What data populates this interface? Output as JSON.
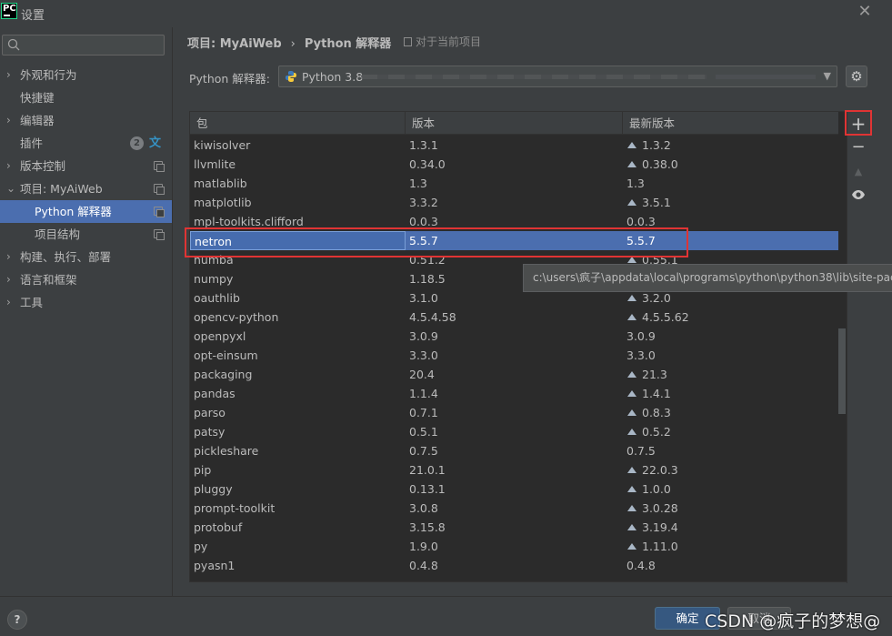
{
  "window": {
    "title": "设置",
    "app_logo_text": "PC"
  },
  "sidebar": {
    "search_placeholder": "Q-",
    "items": [
      {
        "label": "外观和行为",
        "has_chevron": true
      },
      {
        "label": "快捷键",
        "has_chevron": false
      },
      {
        "label": "编辑器",
        "has_chevron": true
      },
      {
        "label": "插件",
        "has_chevron": false,
        "badge": "2"
      },
      {
        "label": "版本控制",
        "has_chevron": true
      },
      {
        "label": "项目: MyAiWeb",
        "has_chevron": true,
        "expanded": true
      },
      {
        "label": "Python 解释器",
        "child": true,
        "selected": true
      },
      {
        "label": "项目结构",
        "child": true
      },
      {
        "label": "构建、执行、部署",
        "has_chevron": true
      },
      {
        "label": "语言和框架",
        "has_chevron": true
      },
      {
        "label": "工具",
        "has_chevron": true
      }
    ]
  },
  "header": {
    "breadcrumb_project": "项目: MyAiWeb",
    "breadcrumb_sep": "›",
    "breadcrumb_page": "Python 解释器",
    "scope_label": "对于当前项目"
  },
  "interpreter": {
    "label": "Python 解释器:",
    "value": "Python 3.8"
  },
  "table": {
    "headers": [
      "包",
      "版本",
      "最新版本"
    ],
    "rows": [
      {
        "name": "kiwisolver",
        "version": "1.3.1",
        "latest": "1.3.2",
        "upgrade": true
      },
      {
        "name": "llvmlite",
        "version": "0.34.0",
        "latest": "0.38.0",
        "upgrade": true
      },
      {
        "name": "matlablib",
        "version": "1.3",
        "latest": "1.3",
        "upgrade": false
      },
      {
        "name": "matplotlib",
        "version": "3.3.2",
        "latest": "3.5.1",
        "upgrade": true
      },
      {
        "name": "mpl-toolkits.clifford",
        "version": "0.0.3",
        "latest": "0.0.3",
        "upgrade": false
      },
      {
        "name": "netron",
        "version": "5.5.7",
        "latest": "5.5.7",
        "upgrade": false,
        "selected": true
      },
      {
        "name": "numba",
        "version": "0.51.2",
        "latest": "0.55.1",
        "upgrade": true
      },
      {
        "name": "numpy",
        "version": "1.18.5",
        "latest": "",
        "upgrade": false
      },
      {
        "name": "oauthlib",
        "version": "3.1.0",
        "latest": "3.2.0",
        "upgrade": true
      },
      {
        "name": "opencv-python",
        "version": "4.5.4.58",
        "latest": "4.5.5.62",
        "upgrade": true
      },
      {
        "name": "openpyxl",
        "version": "3.0.9",
        "latest": "3.0.9",
        "upgrade": false
      },
      {
        "name": "opt-einsum",
        "version": "3.3.0",
        "latest": "3.3.0",
        "upgrade": false
      },
      {
        "name": "packaging",
        "version": "20.4",
        "latest": "21.3",
        "upgrade": true
      },
      {
        "name": "pandas",
        "version": "1.1.4",
        "latest": "1.4.1",
        "upgrade": true
      },
      {
        "name": "parso",
        "version": "0.7.1",
        "latest": "0.8.3",
        "upgrade": true
      },
      {
        "name": "patsy",
        "version": "0.5.1",
        "latest": "0.5.2",
        "upgrade": true
      },
      {
        "name": "pickleshare",
        "version": "0.7.5",
        "latest": "0.7.5",
        "upgrade": false
      },
      {
        "name": "pip",
        "version": "21.0.1",
        "latest": "22.0.3",
        "upgrade": true
      },
      {
        "name": "pluggy",
        "version": "0.13.1",
        "latest": "1.0.0",
        "upgrade": true
      },
      {
        "name": "prompt-toolkit",
        "version": "3.0.8",
        "latest": "3.0.28",
        "upgrade": true
      },
      {
        "name": "protobuf",
        "version": "3.15.8",
        "latest": "3.19.4",
        "upgrade": true
      },
      {
        "name": "py",
        "version": "1.9.0",
        "latest": "1.11.0",
        "upgrade": true
      },
      {
        "name": "pyasn1",
        "version": "0.4.8",
        "latest": "0.4.8",
        "upgrade": false
      }
    ]
  },
  "tooltip": {
    "text": "c:\\users\\疯子\\appdata\\local\\programs\\python\\python38\\lib\\site-pac"
  },
  "toolbar": {
    "add": "+",
    "remove": "−",
    "up": "▲",
    "eye": "◉"
  },
  "footer": {
    "help": "?",
    "ok_label": "确定",
    "cancel_label": "取消"
  },
  "watermark": "CSDN @疯子的梦想@",
  "colors": {
    "selection": "#4b6eaf",
    "highlight_border": "#e03434",
    "background": "#3c3f41",
    "table_bg": "#2b2b2b"
  },
  "icons": {
    "settings": "gear-icon",
    "search": "search-icon",
    "python": "python-icon"
  }
}
